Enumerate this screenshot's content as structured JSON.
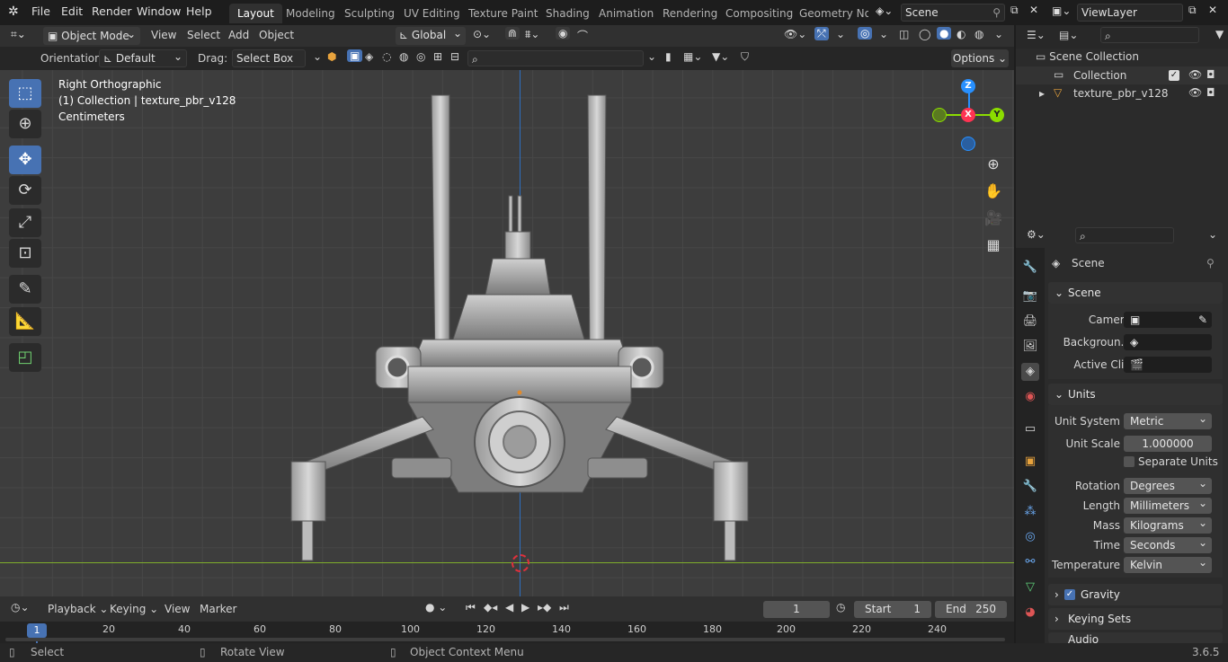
{
  "menu": {
    "items": [
      "File",
      "Edit",
      "Render",
      "Window",
      "Help"
    ]
  },
  "workspace_tabs": [
    "Layout",
    "Modeling",
    "Sculpting",
    "UV Editing",
    "Texture Paint",
    "Shading",
    "Animation",
    "Rendering",
    "Compositing",
    "Geometry Noc"
  ],
  "scene_selector": {
    "value": "Scene"
  },
  "viewlayer_selector": {
    "value": "ViewLayer"
  },
  "viewport_header": {
    "mode": "Object Mode",
    "view": "View",
    "select": "Select",
    "add": "Add",
    "object": "Object",
    "transform_orientation": "Global"
  },
  "tool_settings": {
    "orientation_label": "Orientation:",
    "orientation_value": "Default",
    "drag_label": "Drag:",
    "drag_value": "Select Box",
    "options": "Options"
  },
  "viewport_overlay": {
    "view_name": "Right Orthographic",
    "collection_info": "(1) Collection | texture_pbr_v128",
    "units": "Centimeters"
  },
  "gizmo": {
    "z": "Z",
    "x": "X",
    "y": "Y"
  },
  "outliner": {
    "root": "Scene Collection",
    "items": [
      {
        "label": "Collection"
      },
      {
        "label": "texture_pbr_v128"
      }
    ]
  },
  "properties": {
    "context_title": "Scene",
    "scene_panel": {
      "title": "Scene",
      "camera_label": "Camera",
      "background_label": "Backgroun...",
      "active_clip_label": "Active Clip"
    },
    "units_panel": {
      "title": "Units",
      "unit_system_label": "Unit System",
      "unit_system": "Metric",
      "unit_scale_label": "Unit Scale",
      "unit_scale": "1.000000",
      "separate_units": "Separate Units",
      "rotation_label": "Rotation",
      "rotation": "Degrees",
      "length_label": "Length",
      "length": "Millimeters",
      "mass_label": "Mass",
      "mass": "Kilograms",
      "time_label": "Time",
      "time": "Seconds",
      "temperature_label": "Temperature",
      "temperature": "Kelvin"
    },
    "gravity": "Gravity",
    "keying_sets": "Keying Sets",
    "audio": "Audio"
  },
  "timeline": {
    "playback": "Playback",
    "keying": "Keying",
    "view": "View",
    "marker": "Marker",
    "current_frame": "1",
    "start_label": "Start",
    "start": "1",
    "end_label": "End",
    "end": "250",
    "ticks": [
      "20",
      "40",
      "60",
      "80",
      "100",
      "120",
      "140",
      "160",
      "180",
      "200",
      "220",
      "240"
    ],
    "frame_indicator": "1"
  },
  "statusbar": {
    "select": "Select",
    "rotate_view": "Rotate View",
    "context_menu": "Object Context Menu",
    "version": "3.6.5"
  },
  "colors": {
    "accent": "#4772b3",
    "x_axis": "#ff3352",
    "y_axis": "#8bdc00",
    "z_axis": "#2890ff",
    "header": "#303030",
    "viewport": "#3d3d3d"
  }
}
